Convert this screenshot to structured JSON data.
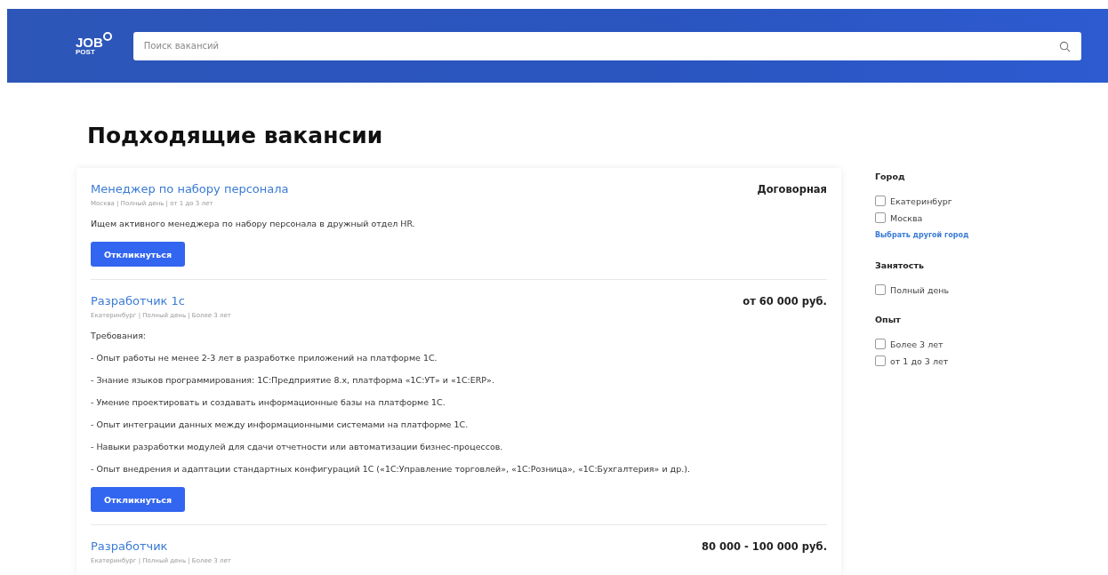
{
  "header": {
    "logo": {
      "main": "JOB",
      "sub": "POST"
    },
    "search": {
      "placeholder": "Поиск вакансий"
    }
  },
  "heading": "Подходящие вакансии",
  "vacancies": [
    {
      "title": "Менеджер по набору персонала",
      "meta": "Москва | Полный день | от 1 до 3 лет",
      "salary": "Договорная",
      "description": [
        "Ищем активного менеджера по набору персонала в дружный отдел HR."
      ],
      "button": "Откликнуться"
    },
    {
      "title": "Разработчик 1с",
      "meta": "Екатеринбург | Полный день | Более 3 лет",
      "salary": "от 60 000 руб.",
      "description": [
        "Требования:",
        "- Опыт работы не менее 2-3 лет в разработке приложений на платформе 1С.",
        "- Знание языков программирования: 1С:Предприятие 8.х, платформа «1С:УТ» и «1С:ERP».",
        "- Умение проектировать и создавать информационные базы на платформе 1С.",
        "- Опыт интеграции данных между информационными системами на платформе 1С.",
        "- Навыки разработки модулей для сдачи отчетности или автоматизации бизнес-процессов.",
        "- Опыт внедрения и адаптации стандартных конфигураций 1С («1С:Управление торговлей», «1С:Розница», «1С:Бухгалтерия» и др.)."
      ],
      "button": "Откликнуться"
    },
    {
      "title": "Разработчик",
      "meta": "Екатеринбург | Полный день | Более 3 лет",
      "salary": "80 000 - 100 000 руб."
    }
  ],
  "filters": [
    {
      "heading": "Город",
      "options": [
        {
          "label": "Екатеринбург",
          "checked": false
        },
        {
          "label": "Москва",
          "checked": false
        }
      ],
      "link": "Выбрать другой город"
    },
    {
      "heading": "Занятость",
      "options": [
        {
          "label": "Полный день",
          "checked": false
        }
      ]
    },
    {
      "heading": "Опыт",
      "options": [
        {
          "label": "Более 3 лет",
          "checked": false
        },
        {
          "label": "от 1 до 3 лет",
          "checked": false
        }
      ]
    }
  ]
}
